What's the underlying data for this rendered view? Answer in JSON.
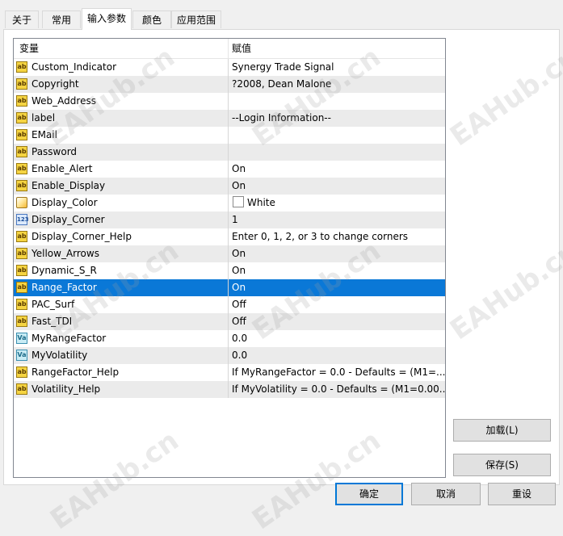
{
  "tabs": [
    {
      "label": "关于"
    },
    {
      "label": "常用"
    },
    {
      "label": "输入参数"
    },
    {
      "label": "颜色"
    },
    {
      "label": "应用范围"
    }
  ],
  "grid": {
    "headers": {
      "variable": "变量",
      "value": "赋值"
    },
    "rows": [
      {
        "name": "Custom_Indicator",
        "value": "Synergy Trade Signal",
        "icon": "ab"
      },
      {
        "name": "Copyright",
        "value": "?2008, Dean Malone",
        "icon": "ab"
      },
      {
        "name": "Web_Address",
        "value": "",
        "icon": "ab"
      },
      {
        "name": "label",
        "value": "--Login Information--",
        "icon": "ab"
      },
      {
        "name": "EMail",
        "value": "",
        "icon": "ab"
      },
      {
        "name": "Password",
        "value": "",
        "icon": "ab"
      },
      {
        "name": "Enable_Alert",
        "value": "On",
        "icon": "ab"
      },
      {
        "name": "Enable_Display",
        "value": "On",
        "icon": "ab"
      },
      {
        "name": "Display_Color",
        "value": "White",
        "icon": "color"
      },
      {
        "name": "Display_Corner",
        "value": "1",
        "icon": "123"
      },
      {
        "name": "Display_Corner_Help",
        "value": "Enter 0, 1, 2, or 3 to change corners",
        "icon": "ab"
      },
      {
        "name": "Yellow_Arrows",
        "value": "On",
        "icon": "ab"
      },
      {
        "name": "Dynamic_S_R",
        "value": "On",
        "icon": "ab"
      },
      {
        "name": "Range_Factor",
        "value": "On",
        "icon": "ab"
      },
      {
        "name": "PAC_Surf",
        "value": "Off",
        "icon": "ab"
      },
      {
        "name": "Fast_TDI",
        "value": "Off",
        "icon": "ab"
      },
      {
        "name": "MyRangeFactor",
        "value": "0.0",
        "icon": "Va"
      },
      {
        "name": "MyVolatility",
        "value": "0.0",
        "icon": "Va"
      },
      {
        "name": "RangeFactor_Help",
        "value": "If MyRangeFactor = 0.0 - Defaults = (M1=...",
        "icon": "ab"
      },
      {
        "name": "Volatility_Help",
        "value": "If MyVolatility = 0.0 - Defaults = (M1=0.00...",
        "icon": "ab"
      }
    ]
  },
  "buttons": {
    "load": "加载(L)",
    "save": "保存(S)",
    "ok": "确定",
    "cancel": "取消",
    "reset": "重设"
  },
  "watermark": "EAHub.cn",
  "colors": {
    "selection": "#0a78d7",
    "display_color_swatch": "#ffffff"
  }
}
